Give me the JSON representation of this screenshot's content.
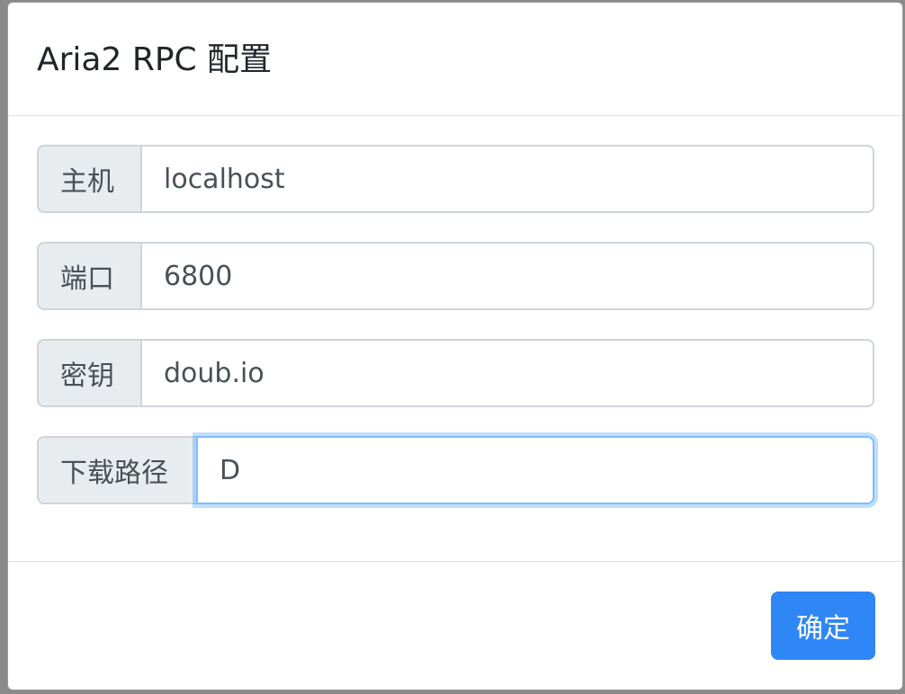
{
  "dialog": {
    "title": "Aria2 RPC 配置",
    "fields": [
      {
        "label": "主机",
        "value": "localhost"
      },
      {
        "label": "端口",
        "value": "6800"
      },
      {
        "label": "密钥",
        "value": "doub.io"
      },
      {
        "label": "下载路径",
        "value": "D"
      }
    ],
    "confirm_label": "确定"
  },
  "colors": {
    "primary": "#2f86f6",
    "addon_bg": "#e9ecef",
    "focus_border": "#80bdff"
  }
}
